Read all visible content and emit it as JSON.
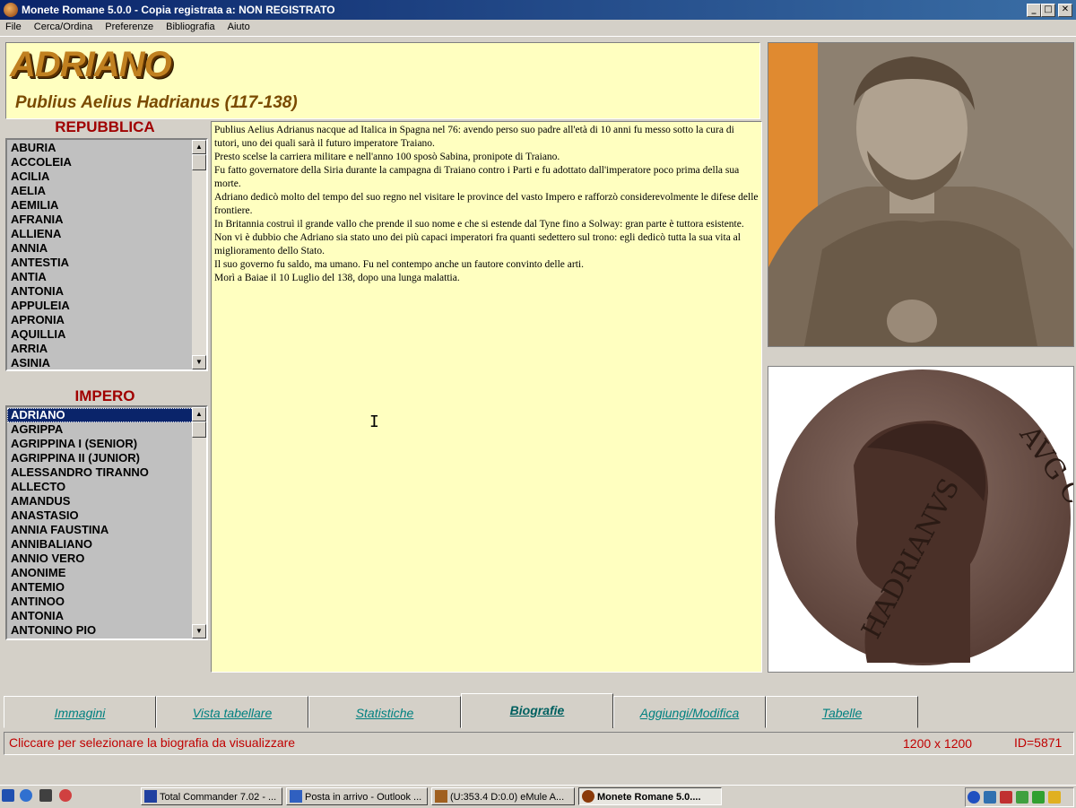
{
  "window": {
    "title": "Monete Romane 5.0.0 - Copia registrata a:  NON REGISTRATO",
    "min_glyph": "_",
    "max_glyph": "□",
    "close_glyph": "✕"
  },
  "menu": [
    "File",
    "Cerca/Ordina",
    "Preferenze",
    "Bibliografia",
    "Aiuto"
  ],
  "header": {
    "name": "ADRIANO",
    "full_name": "Publius Aelius Hadrianus (117-138)"
  },
  "republic": {
    "title": "REPUBBLICA",
    "items": [
      "ABURIA",
      "ACCOLEIA",
      "ACILIA",
      "AELIA",
      "AEMILIA",
      "AFRANIA",
      "ALLIENA",
      "ANNIA",
      "ANTESTIA",
      "ANTIA",
      "ANTONIA",
      "APPULEIA",
      "APRONIA",
      "AQUILLIA",
      "ARRIA",
      "ASINIA"
    ]
  },
  "empire": {
    "title": "IMPERO",
    "selected": "ADRIANO",
    "items": [
      "ADRIANO",
      "AGRIPPA",
      "AGRIPPINA I (SENIOR)",
      "AGRIPPINA II (JUNIOR)",
      "ALESSANDRO TIRANNO",
      "ALLECTO",
      "AMANDUS",
      "ANASTASIO",
      "ANNIA FAUSTINA",
      "ANNIBALIANO",
      "ANNIO VERO",
      "ANONIME",
      "ANTEMIO",
      "ANTINOO",
      "ANTONIA",
      "ANTONINO PIO"
    ]
  },
  "biography": [
    "Publius Aelius Adrianus nacque ad Italica in Spagna nel 76: avendo perso suo padre all'età di 10 anni fu messo sotto la cura di tutori, uno dei quali sarà il futuro imperatore Traiano.",
    "Presto scelse la carriera militare e nell'anno 100 sposò Sabina, pronipote di Traiano.",
    "Fu fatto governatore della Siria durante la campagna di Traiano contro i Parti e fu adottato dall'imperatore poco prima della sua morte.",
    "Adriano dedicò molto del tempo del suo regno nel visitare le province del vasto Impero e rafforzò considerevolmente le difese delle frontiere.",
    "In Britannia costruì il grande vallo che prende il suo nome e che si estende dal Tyne fino a Solway: gran parte è tuttora esistente.",
    "Non vi è dubbio che Adriano sia stato uno dei più capaci imperatori fra quanti sedettero sul trono: egli dedicò tutta la sua vita al miglioramento dello Stato.",
    "Il suo governo fu saldo, ma umano. Fu nel contempo anche un fautore convinto delle arti.",
    "Morì a Baiae il 10 Luglio del 138, dopo una lunga malattia."
  ],
  "coin": {
    "legend_left": "HADRIANVS",
    "legend_right": "AVG COS III P P"
  },
  "tabs": [
    {
      "label": "Immagini",
      "active": false
    },
    {
      "label": "Vista tabellare",
      "active": false
    },
    {
      "label": "Statistiche",
      "active": false
    },
    {
      "label": "Biografie",
      "active": true
    },
    {
      "label": "Aggiungi/Modifica",
      "active": false
    },
    {
      "label": "Tabelle",
      "active": false
    }
  ],
  "status": {
    "message": "Cliccare per selezionare la biografia da visualizzare",
    "dimensions": "1200 x 1200",
    "id": "ID=5871"
  },
  "taskbar": {
    "buttons": [
      {
        "label": "Total Commander 7.02 - ...",
        "icon": "floppy-icon",
        "active": false
      },
      {
        "label": "Posta in arrivo - Outlook ...",
        "icon": "outlook-icon",
        "active": false
      },
      {
        "label": "(U:353.4 D:0.0) eMule A...",
        "icon": "emule-icon",
        "active": false
      },
      {
        "label": "Monete Romane 5.0....",
        "icon": "coin-app-icon",
        "active": true
      }
    ]
  },
  "colors": {
    "title_bar": "#0a246a",
    "panel_yellow": "#ffffc0",
    "section_red": "#a00000",
    "tab_teal": "#008080",
    "status_red": "#c00000"
  }
}
